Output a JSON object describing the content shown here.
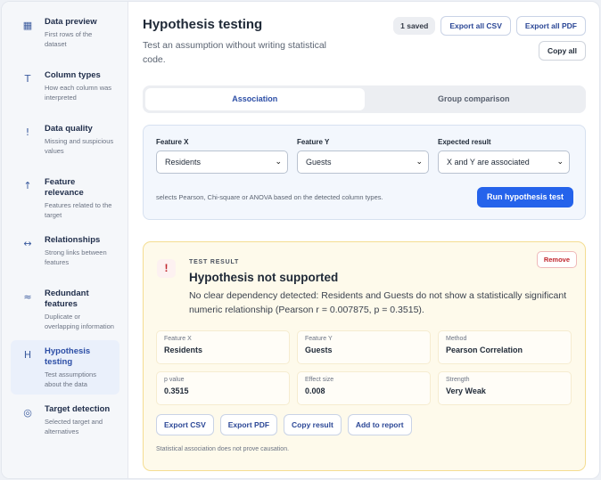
{
  "sidebar": {
    "items": [
      {
        "icon": "table-icon",
        "glyph": "▦",
        "title": "Data preview",
        "desc": "First rows of the dataset",
        "active": false
      },
      {
        "icon": "type-icon",
        "glyph": "T",
        "title": "Column types",
        "desc": "How each column was interpreted",
        "active": false
      },
      {
        "icon": "exclamation-icon",
        "glyph": "!",
        "title": "Data quality",
        "desc": "Missing and suspicious values",
        "active": false
      },
      {
        "icon": "arrow-up-icon",
        "glyph": "↑",
        "title": "Feature relevance",
        "desc": "Features related to the target",
        "active": false
      },
      {
        "icon": "double-arrow-icon",
        "glyph": "↔",
        "title": "Relationships",
        "desc": "Strong links between features",
        "active": false
      },
      {
        "icon": "approx-icon",
        "glyph": "≈",
        "title": "Redundant features",
        "desc": "Duplicate or overlapping information",
        "active": false
      },
      {
        "icon": "h-icon",
        "glyph": "H",
        "title": "Hypothesis testing",
        "desc": "Test assumptions about the data",
        "active": true
      },
      {
        "icon": "target-icon",
        "glyph": "◎",
        "title": "Target detection",
        "desc": "Selected target and alternatives",
        "active": false
      }
    ]
  },
  "header": {
    "title": "Hypothesis testing",
    "subtitle": "Test an assumption without writing statistical code.",
    "saved_badge": "1 saved",
    "export_csv": "Export all CSV",
    "export_pdf": "Export all PDF",
    "copy_all": "Copy all"
  },
  "tabs": [
    {
      "label": "Association",
      "active": true
    },
    {
      "label": "Group comparison",
      "active": false
    }
  ],
  "form": {
    "feature_x_label": "Feature X",
    "feature_x_value": "Residents",
    "feature_y_label": "Feature Y",
    "feature_y_value": "Guests",
    "expected_label": "Expected result",
    "expected_value": "X and Y are associated",
    "hint": "selects Pearson, Chi-square or ANOVA based on the detected column types.",
    "run_button": "Run hypothesis test"
  },
  "result": {
    "eyebrow": "TEST RESULT",
    "title": "Hypothesis not supported",
    "text": "No clear dependency detected: Residents and Guests do not show a statistically significant numeric relationship (Pearson r = 0.007875, p = 0.3515).",
    "remove": "Remove",
    "metrics": [
      {
        "label": "Feature X",
        "value": "Residents"
      },
      {
        "label": "Feature Y",
        "value": "Guests"
      },
      {
        "label": "Method",
        "value": "Pearson Correlation"
      },
      {
        "label": "p value",
        "value": "0.3515"
      },
      {
        "label": "Effect size",
        "value": "0.008"
      },
      {
        "label": "Strength",
        "value": "Very Weak"
      }
    ],
    "actions": {
      "export_csv": "Export CSV",
      "export_pdf": "Export PDF",
      "copy": "Copy result",
      "add_report": "Add to report"
    },
    "disclaimer": "Statistical association does not prove causation."
  },
  "colors": {
    "accent": "#2563eb",
    "result_bg": "#fefaeb",
    "danger": "#c0262d"
  }
}
